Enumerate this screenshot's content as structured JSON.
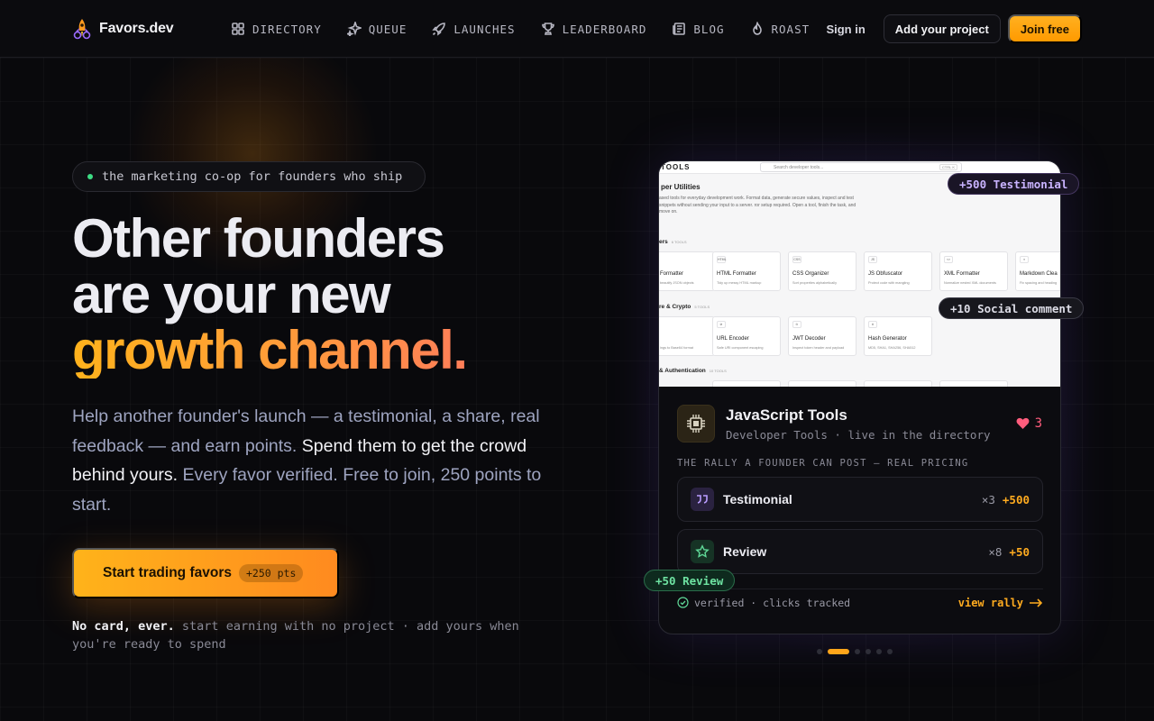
{
  "brand": {
    "name": "Favors.dev"
  },
  "nav": {
    "links": [
      {
        "label": "DIRECTORY",
        "icon": "grid-icon"
      },
      {
        "label": "QUEUE",
        "icon": "sparkles-icon"
      },
      {
        "label": "LAUNCHES",
        "icon": "rocket-icon"
      },
      {
        "label": "LEADERBOARD",
        "icon": "trophy-icon"
      },
      {
        "label": "BLOG",
        "icon": "newspaper-icon"
      },
      {
        "label": "ROAST",
        "icon": "flame-icon"
      }
    ],
    "sign_in": "Sign in",
    "add_project": "Add your project",
    "join": "Join free"
  },
  "hero": {
    "pill": "the marketing co-op for founders who ship",
    "headline_1": "Other founders",
    "headline_2": "are your new",
    "headline_3": "growth channel.",
    "lede_a": "Help another founder's launch — a testimonial, a share, real feedback — and earn points. ",
    "lede_b": "Spend them to get the crowd behind yours.",
    "lede_c": " Every favor verified. Free to join, 250 points to start.",
    "cta_label": "Start trading favors",
    "cta_badge": "+250 pts",
    "fine_bold": "No card, ever.",
    "fine_rest": " start earning with no project · add yours when you're ready to spend"
  },
  "card": {
    "shot": {
      "brand": "TOOLS",
      "search_placeholder": "Search developer tools...",
      "search_key": "CTRL K",
      "heading": "per Utilities",
      "desc": "ased tools for everyday development work. Format data, generate secure values, inspect and test snippets without sending your input to a server. ror setup required. Open a tool, finish the task, and move on.",
      "sections": [
        {
          "title": "ers",
          "count": "6 TOOLS"
        },
        {
          "title": "re & Crypto",
          "count": "5 TOOLS"
        },
        {
          "title": "& Authentication",
          "count": "10 TOOLS"
        }
      ],
      "tiles_row1": [
        {
          "icon": "",
          "name": "Formatter",
          "desc": "beautify JSON objects"
        },
        {
          "icon": "HTML",
          "name": "HTML Formatter",
          "desc": "Tidy up messy HTML markup"
        },
        {
          "icon": "CSS",
          "name": "CSS Organizer",
          "desc": "Sort properties alphabetically"
        },
        {
          "icon": "JS",
          "name": "JS Obfuscator",
          "desc": "Protect code with mangling"
        },
        {
          "icon": "<>",
          "name": "XML Formatter",
          "desc": "Normalize nested XML documents"
        },
        {
          "icon": "≡",
          "name": "Markdown Clea",
          "desc": "Fix spacing and heading"
        }
      ],
      "tiles_row2": [
        {
          "icon": "",
          "name": "",
          "desc": "ings to Base64 format"
        },
        {
          "icon": "⊘",
          "name": "URL Encoder",
          "desc": "Safe URI component escaping"
        },
        {
          "icon": "⊙",
          "name": "JWT Decoder",
          "desc": "Inspect token header and payload"
        },
        {
          "icon": "#",
          "name": "Hash Generator",
          "desc": "MD5, SHA1, SHA256, SHA512"
        }
      ]
    },
    "badges": {
      "testimonial": "+500 Testimonial",
      "social": "+10 Social comment",
      "review": "+50 Review"
    },
    "project_name": "JavaScript Tools",
    "project_category": "Developer Tools",
    "project_status": "live in the directory",
    "likes": "3",
    "rally_label": "THE RALLY A FOUNDER CAN POST — REAL PRICING",
    "rows": [
      {
        "name": "Testimonial",
        "count": "×3",
        "points": "+500"
      },
      {
        "name": "Review",
        "count": "×8",
        "points": "+50"
      }
    ],
    "verified": "verified · clicks tracked",
    "view_rally": "view rally"
  },
  "colors": {
    "accent": "#ffab1f",
    "purple": "#c9b3ff",
    "green": "#6ee3a2",
    "heart": "#ff5d7d"
  }
}
